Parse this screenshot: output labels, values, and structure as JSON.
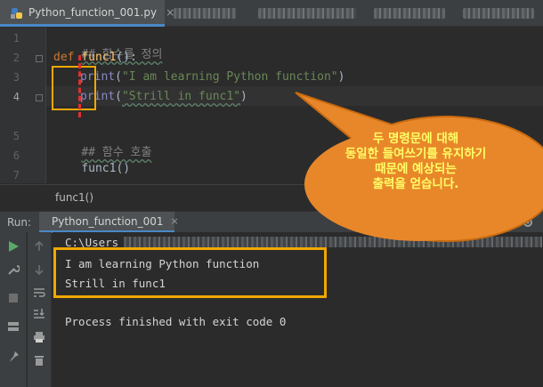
{
  "tab": {
    "filename": "Python_function_001.py",
    "close": "×"
  },
  "editor": {
    "lines": [
      {
        "n": "1"
      },
      {
        "n": "2"
      },
      {
        "n": "3"
      },
      {
        "n": "4"
      },
      {
        "n": "5"
      },
      {
        "n": "6"
      },
      {
        "n": "7"
      },
      {
        "n": "8"
      }
    ],
    "comment1": "## 함수를 정의",
    "def_kw": "def",
    "func_name": "func1",
    "def_tail": "():",
    "print1": "print",
    "str1": "\"I am learning Python function\"",
    "print2": "print",
    "str2": "\"Strill in func1\"",
    "paren_open": "(",
    "paren_close": ")",
    "comment2": "## 함수 호출",
    "call": "func1()",
    "breadcrumb": "func1()"
  },
  "run": {
    "label": "Run:",
    "tab_label": "Python_function_001",
    "tab_close": "×",
    "console": {
      "path_prefix": "C:\\Users",
      "out1": "I am learning Python function",
      "out2": "Strill in func1",
      "exit": "Process finished with exit code 0"
    }
  },
  "annotation": {
    "lines": [
      "두 명령문에 대해",
      "동일한 들여쓰기를 유지하기",
      "때문에 예상되는",
      "출력을 얻습니다."
    ]
  },
  "colors": {
    "keyword": "#cc7832",
    "function": "#ffc66d",
    "string": "#6a8759",
    "comment": "#808080",
    "highlight_box": "#f0a800",
    "bubble_fill": "#e8872a",
    "bubble_text": "#ffff66"
  }
}
